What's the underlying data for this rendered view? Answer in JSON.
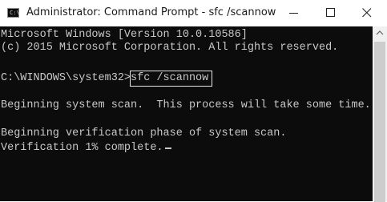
{
  "window": {
    "title": "Administrator: Command Prompt - sfc  /scannow",
    "icon": "command-prompt-icon",
    "icon_text": "C:\\"
  },
  "titlebar_buttons": {
    "minimize_icon": "minimize-icon",
    "maximize_icon": "maximize-icon",
    "close_icon": "close-icon"
  },
  "console": {
    "line1": "Microsoft Windows [Version 10.0.10586]",
    "line2": "(c) 2015 Microsoft Corporation. All rights reserved.",
    "prompt": "C:\\WINDOWS\\system32>",
    "command": "sfc /scannow",
    "line4": "Beginning system scan.  This process will take some time.",
    "line5": "Beginning verification phase of system scan.",
    "line6": "Verification 1% complete."
  },
  "colors": {
    "console_bg": "#0c0c0c",
    "console_text": "#c8c8c8",
    "titlebar_bg": "#ffffff",
    "scrollbar_bg": "#f0f0f0"
  }
}
